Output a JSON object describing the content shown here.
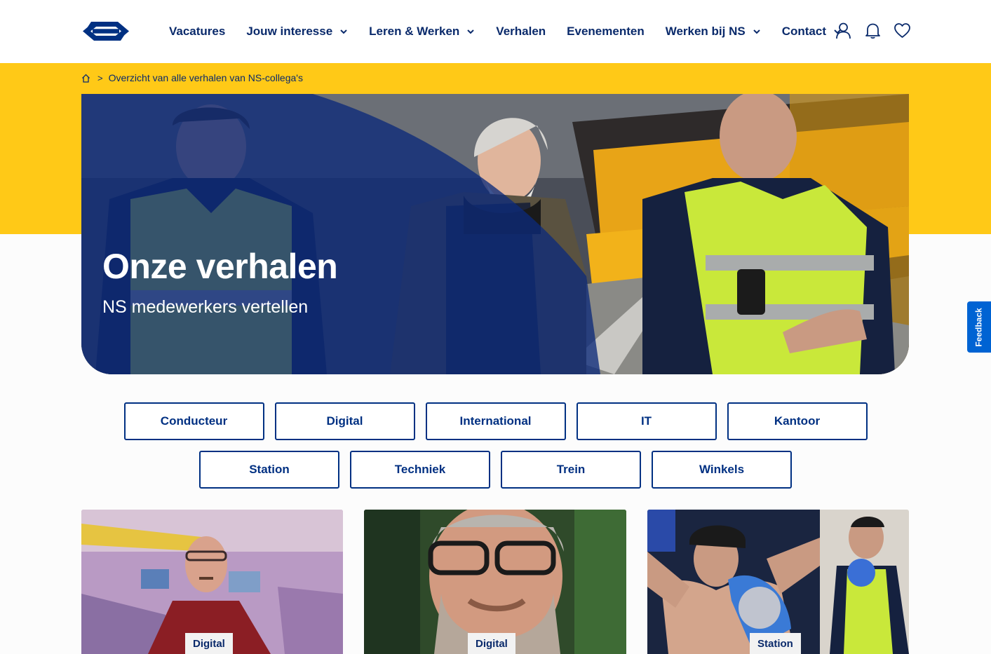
{
  "header": {
    "nav": [
      {
        "label": "Vacatures",
        "has_dropdown": false
      },
      {
        "label": "Jouw interesse",
        "has_dropdown": true
      },
      {
        "label": "Leren & Werken",
        "has_dropdown": true
      },
      {
        "label": "Verhalen",
        "has_dropdown": false
      },
      {
        "label": "Evenementen",
        "has_dropdown": false
      },
      {
        "label": "Werken bij NS",
        "has_dropdown": true
      },
      {
        "label": "Contact",
        "has_dropdown": true
      }
    ],
    "icons": [
      "user-icon",
      "bell-icon",
      "heart-icon"
    ]
  },
  "breadcrumb": {
    "home_icon": "home-icon",
    "current": "Overzicht van alle verhalen van NS-collega's"
  },
  "hero": {
    "title": "Onze verhalen",
    "subtitle": "NS medewerkers vertellen"
  },
  "feedback": {
    "label": "Feedback"
  },
  "filters": {
    "row1": [
      "Conducteur",
      "Digital",
      "International",
      "IT",
      "Kantoor"
    ],
    "row2": [
      "Station",
      "Techniek",
      "Trein",
      "Winkels"
    ]
  },
  "cards": [
    {
      "tag": "Digital"
    },
    {
      "tag": "Digital"
    },
    {
      "tag": "Station"
    }
  ],
  "colors": {
    "brand_blue": "#003082",
    "brand_yellow": "#ffc917",
    "feedback_blue": "#0063d3"
  }
}
